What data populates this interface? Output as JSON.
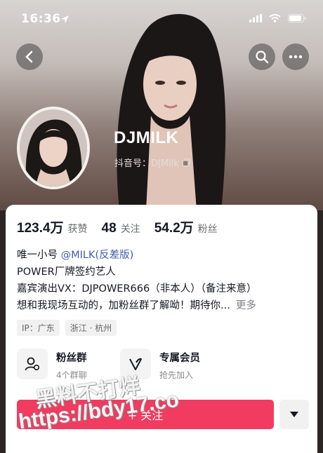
{
  "status_bar": {
    "time": "16:36"
  },
  "profile": {
    "nickname": "DJMILK",
    "douyin_id": "抖音号：DJMilk"
  },
  "stats": [
    {
      "value": "123.4万",
      "label": "获赞"
    },
    {
      "value": "48",
      "label": "关注"
    },
    {
      "value": "54.2万",
      "label": "粉丝"
    }
  ],
  "bio": {
    "line1_prefix": "唯一小号 ",
    "line1_mention": "@MILK(反差版)",
    "line2": "POWER厂牌签约艺人",
    "line3": "嘉宾演出VX：DJPOWER666（非本人）（备注来意）",
    "line4": "想和我现场互动的，加粉丝群了解呦！期待你...",
    "more": "更多"
  },
  "tags": [
    "IP：广东",
    "浙江 · 杭州"
  ],
  "features": {
    "fans_group": {
      "title": "粉丝群",
      "subtitle": "4个群聊"
    },
    "membership": {
      "title": "专属会员",
      "subtitle": "抢先加入"
    }
  },
  "follow_button": "+ 关注",
  "watermark": {
    "line1": "黑料不打烊",
    "line2": "https://bdy17.co"
  },
  "colors": {
    "follow": "#f23b60",
    "mention": "#3f5da8"
  }
}
